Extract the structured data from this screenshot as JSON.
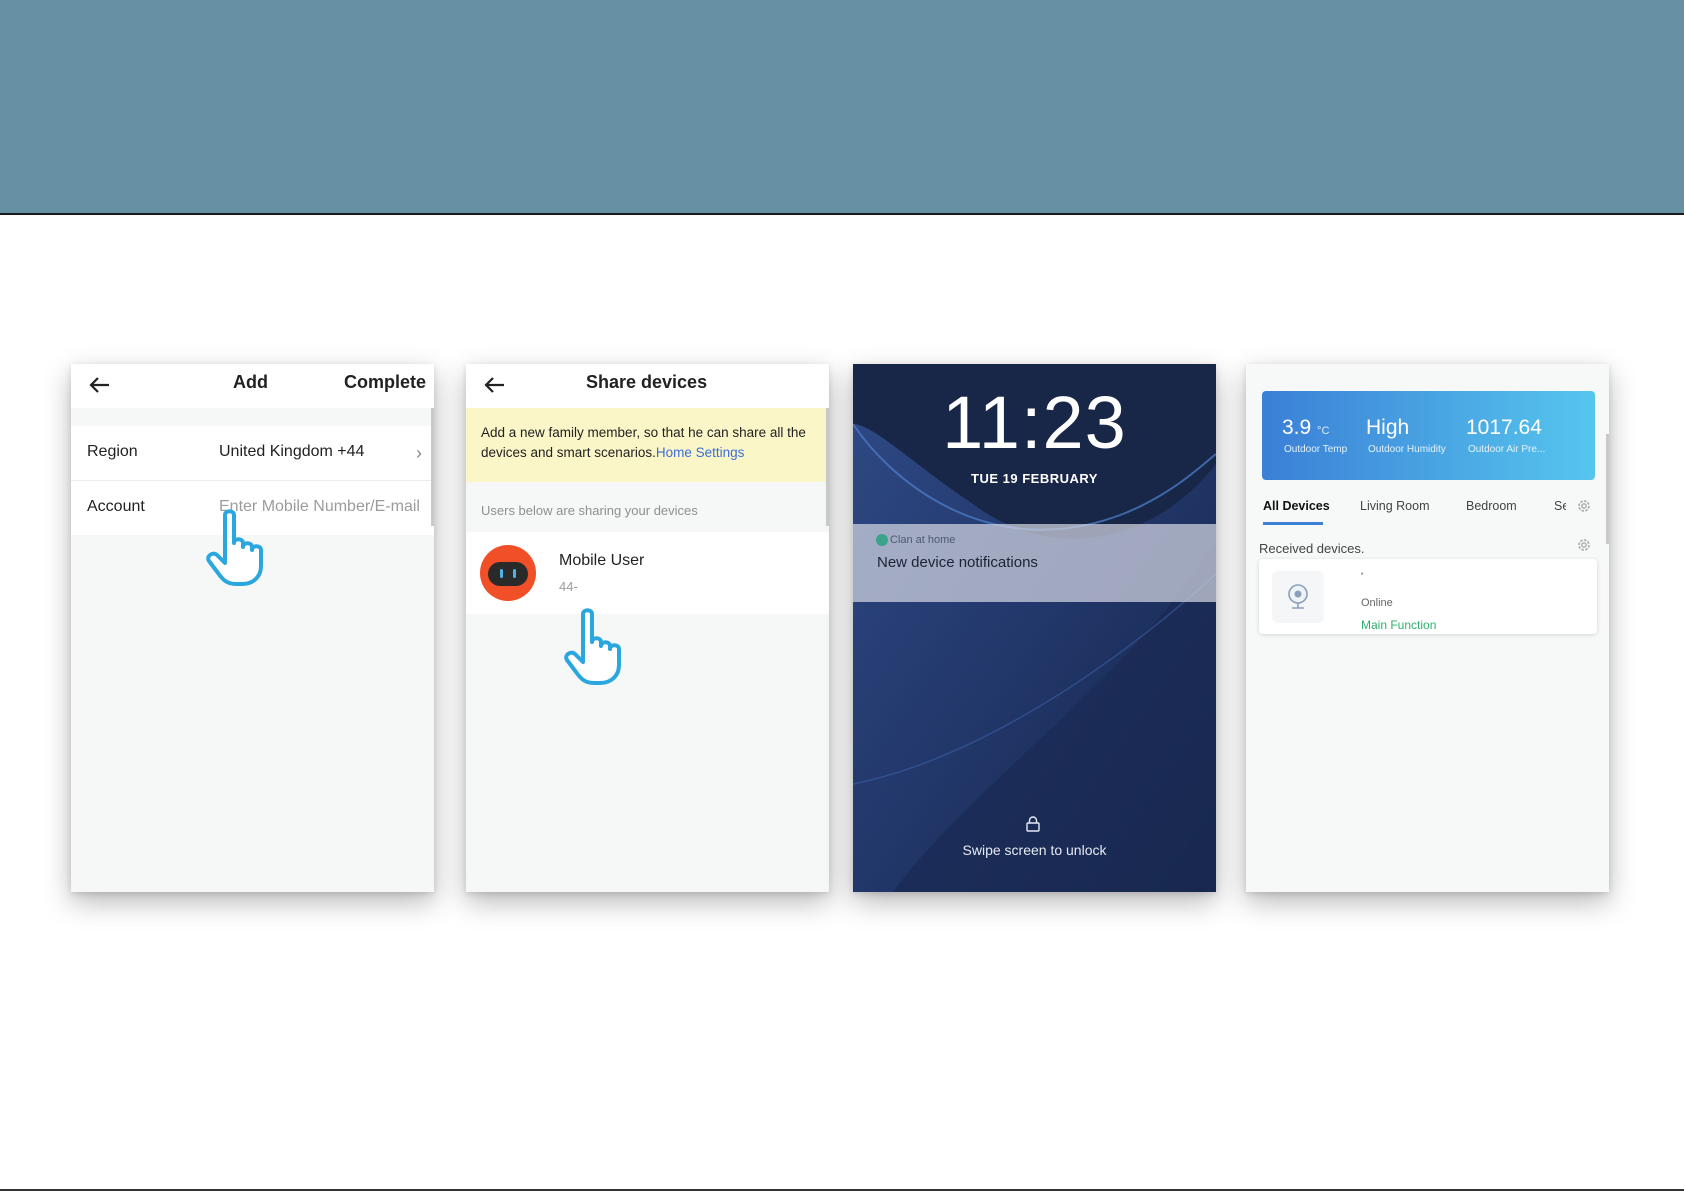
{
  "screen1": {
    "title": "Add",
    "complete_label": "Complete",
    "region_label": "Region",
    "region_value": "United Kingdom +44",
    "account_label": "Account",
    "account_placeholder": "Enter Mobile Number/E-mail"
  },
  "screen2": {
    "title": "Share devices",
    "notice_text": "Add a new family member, so that he can share all the devices and smart scenarios.",
    "notice_link": "Home Settings",
    "section_label": "Users below are sharing your devices",
    "member_name": "Mobile User",
    "member_phone": "44-"
  },
  "screen3": {
    "time": "11:23",
    "date": "TUE 19 FEBRUARY",
    "notification_app": "Clan at home",
    "notification_title": "New device notifications",
    "unlock_text": "Swipe screen to unlock"
  },
  "screen4": {
    "weather": [
      {
        "value": "3.9",
        "unit": "°C",
        "label": "Outdoor Temp"
      },
      {
        "value": "High",
        "unit": "",
        "label": "Outdoor Humidity"
      },
      {
        "value": "1017.64",
        "unit": "",
        "label": "Outdoor Air Pre..."
      }
    ],
    "tabs": [
      "All Devices",
      "Living Room",
      "Bedroom",
      "Se"
    ],
    "received_label": "Received devices.",
    "device_name": "'",
    "device_status": "Online",
    "device_action": "Main Function"
  },
  "colors": {
    "banner": "#6690a4",
    "accent_blue": "#3b7fd6",
    "pointer_blue": "#2aa7df",
    "success_green": "#2fb06c",
    "notice_yellow": "#fbf6c7"
  },
  "icons": [
    "back-arrow-icon",
    "chevron-right-icon",
    "pointer-hand-icon",
    "robot-avatar-icon",
    "lock-icon",
    "gear-icon",
    "camera-icon"
  ]
}
